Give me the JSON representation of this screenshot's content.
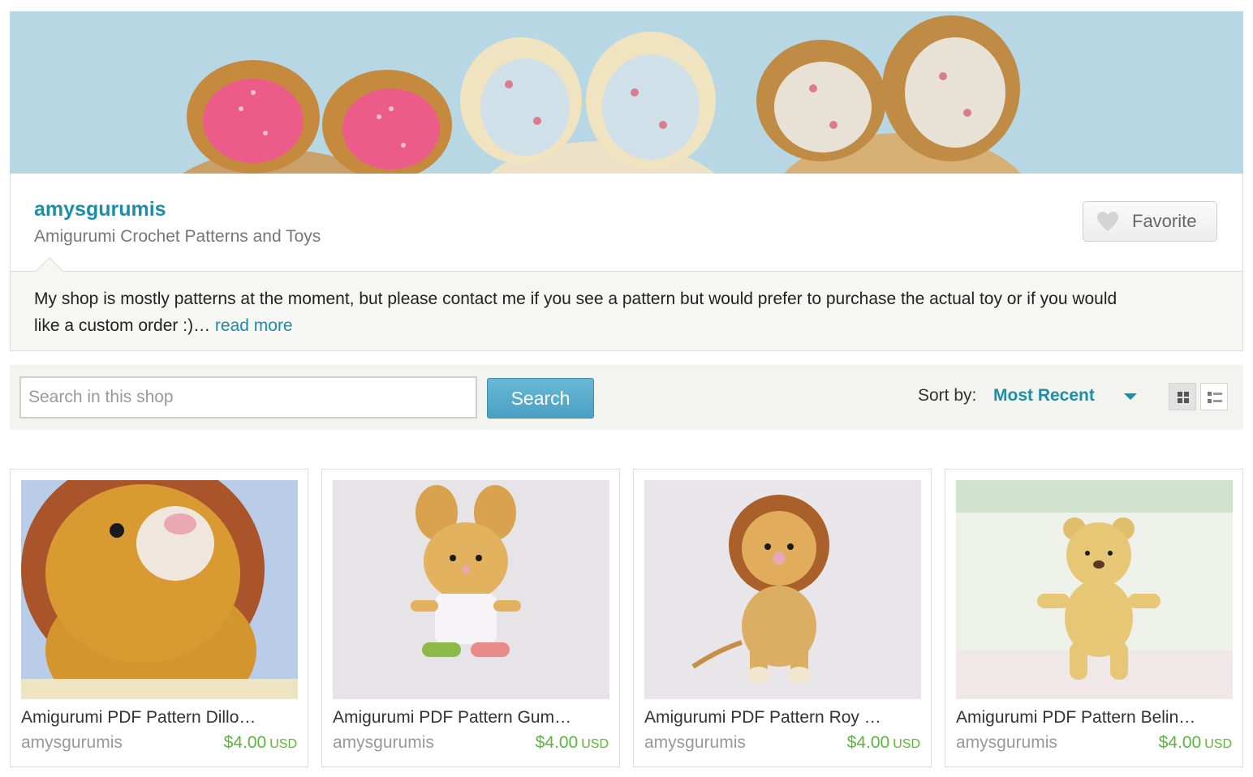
{
  "shop": {
    "name": "amysgurumis",
    "tagline": "Amigurumi Crochet Patterns and Toys",
    "favorite_label": "Favorite",
    "announcement": "My shop is mostly patterns at the moment, but please contact me if you see a pattern but would prefer to purchase the actual toy or if you would like a custom order :)… ",
    "read_more_label": "read more"
  },
  "toolbar": {
    "search_placeholder": "Search in this shop",
    "search_button": "Search",
    "sort_label": "Sort by:",
    "sort_value": "Most Recent"
  },
  "listings": [
    {
      "title": "Amigurumi PDF Pattern Dillo…",
      "seller": "amysgurumis",
      "price": "$4.00",
      "currency": "USD"
    },
    {
      "title": "Amigurumi PDF Pattern Gum…",
      "seller": "amysgurumis",
      "price": "$4.00",
      "currency": "USD"
    },
    {
      "title": "Amigurumi PDF Pattern Roy …",
      "seller": "amysgurumis",
      "price": "$4.00",
      "currency": "USD"
    },
    {
      "title": "Amigurumi PDF Pattern Belin…",
      "seller": "amysgurumis",
      "price": "$4.00",
      "currency": "USD"
    }
  ],
  "colors": {
    "accent": "#1a8fa8",
    "price": "#5db53a",
    "banner_bg": "#b5d6e4"
  },
  "icons": {
    "favorite": "heart-icon",
    "sort": "caret-down-icon",
    "grid_view": "grid-view-icon",
    "list_view": "list-view-icon"
  }
}
